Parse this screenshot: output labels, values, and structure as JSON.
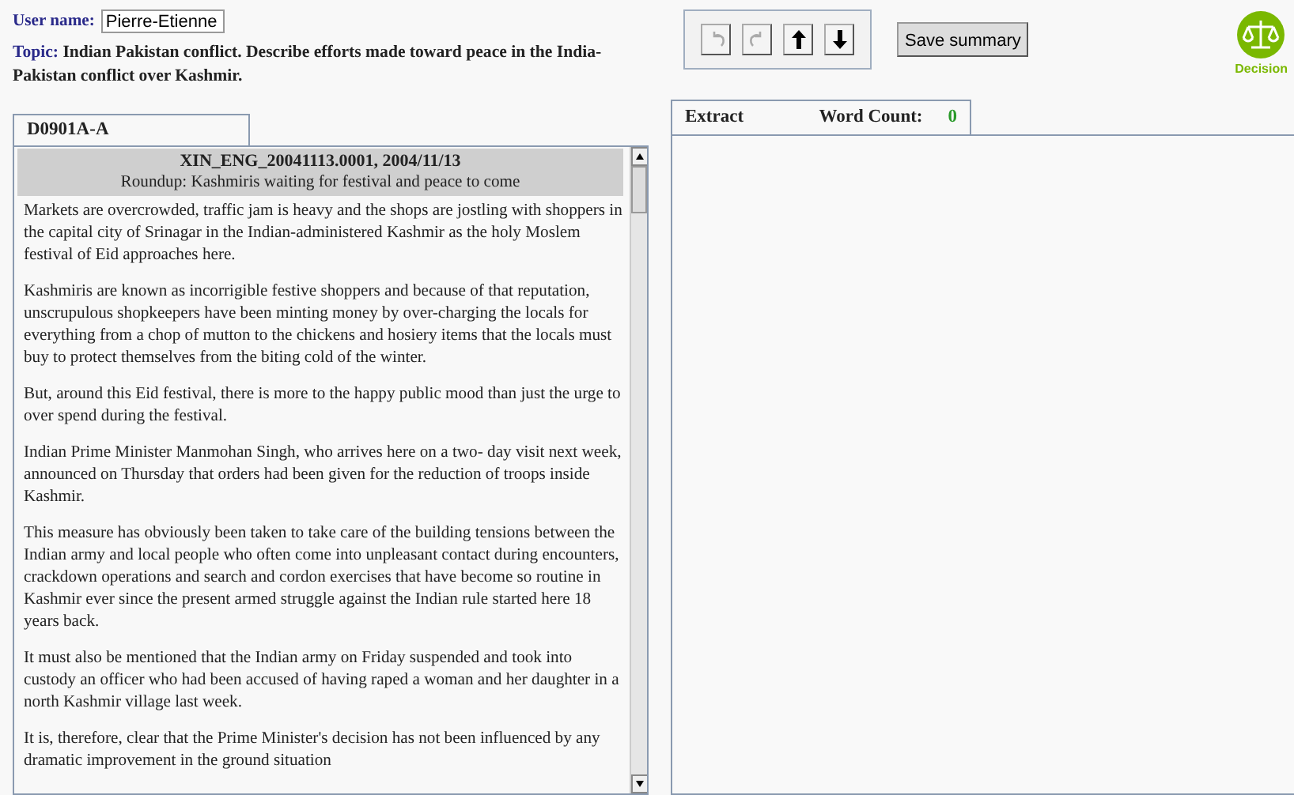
{
  "user": {
    "label": "User name:",
    "value": "Pierre-Etienne"
  },
  "topic": {
    "label": "Topic:",
    "text": "Indian Pakistan conflict. Describe efforts made toward peace in the India-Pakistan conflict over Kashmir."
  },
  "toolbar": [
    {
      "kind": "undo",
      "disabled": true
    },
    {
      "kind": "redo",
      "disabled": true
    },
    {
      "kind": "up",
      "disabled": false
    },
    {
      "kind": "down",
      "disabled": false
    }
  ],
  "save_button": "Save summary",
  "logo": {
    "text": "Decision"
  },
  "document": {
    "tab": "D0901A-A",
    "title": "XIN_ENG_20041113.0001, 2004/11/13",
    "headline": "Roundup: Kashmiris waiting for festival and peace to come",
    "paragraphs": [
      "Markets are overcrowded, traffic jam is heavy and the shops are jostling with shoppers in the capital city of Srinagar in the Indian-administered Kashmir as the holy Moslem festival of Eid approaches here.",
      "Kashmiris are known as incorrigible festive shoppers and because of that reputation, unscrupulous shopkeepers have been minting money by over-charging the locals for everything from a chop of mutton to the chickens and hosiery items that the locals must buy to protect themselves from the biting cold of the winter.",
      "But, around this Eid festival, there is more to the happy public mood than just the urge to over spend during the festival.",
      "Indian Prime Minister Manmohan Singh, who arrives here on a two- day visit next week, announced on Thursday that orders had been given for the reduction of troops inside Kashmir.",
      "This measure has obviously been taken to take care of the building tensions between the Indian army and local people who often come into unpleasant contact during encounters, crackdown operations and search and cordon exercises that have become so routine in Kashmir ever since the present armed struggle against the Indian rule started here 18 years back.",
      "It must also be mentioned that the Indian army on Friday suspended and took into custody an officer who had been accused of having raped a woman and her daughter in a north Kashmir village last week.",
      "It is, therefore, clear that the Prime Minister's decision has not been influenced by any dramatic improvement in the ground situation"
    ]
  },
  "extract": {
    "label": "Extract",
    "count_label": "Word Count:",
    "count": "0"
  }
}
